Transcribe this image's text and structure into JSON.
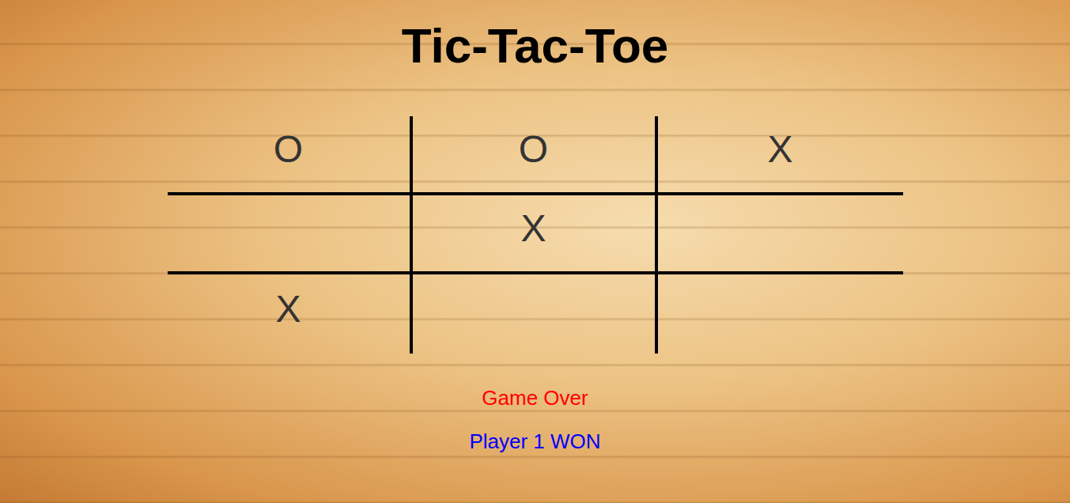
{
  "title": "Tic-Tac-Toe",
  "board": {
    "cells": [
      {
        "mark": "O"
      },
      {
        "mark": "O"
      },
      {
        "mark": "X"
      },
      {
        "mark": ""
      },
      {
        "mark": "X"
      },
      {
        "mark": ""
      },
      {
        "mark": "X"
      },
      {
        "mark": ""
      },
      {
        "mark": ""
      }
    ]
  },
  "status": {
    "message": "Game Over",
    "result": "Player 1 WON"
  }
}
